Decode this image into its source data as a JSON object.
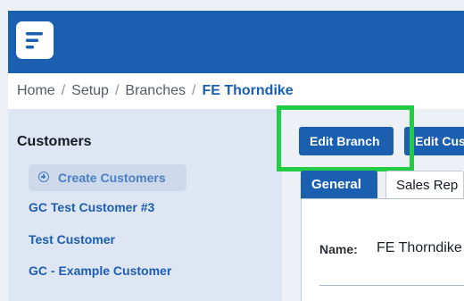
{
  "header": {
    "logo_icon": "app-logo-icon",
    "brand_color": "#1b5fb0"
  },
  "breadcrumb": {
    "items": [
      "Home",
      "Setup",
      "Branches"
    ],
    "current": "FE Thorndike",
    "separator": "/"
  },
  "sidebar": {
    "title": "Customers",
    "create_button": {
      "label": "Create Customers",
      "icon": "plus-circle-icon"
    },
    "customers": [
      "GC Test Customer #3",
      "Test Customer",
      "GC - Example Customer"
    ]
  },
  "main": {
    "actions": {
      "edit_branch": "Edit Branch",
      "edit_customers": "Edit Cus"
    },
    "highlight_color": "#22cc44",
    "tabs": [
      {
        "label": "General",
        "active": true
      },
      {
        "label": "Sales Rep",
        "active": false
      }
    ],
    "fields": {
      "name_label": "Name:",
      "name_value": "FE Thorndike"
    }
  }
}
